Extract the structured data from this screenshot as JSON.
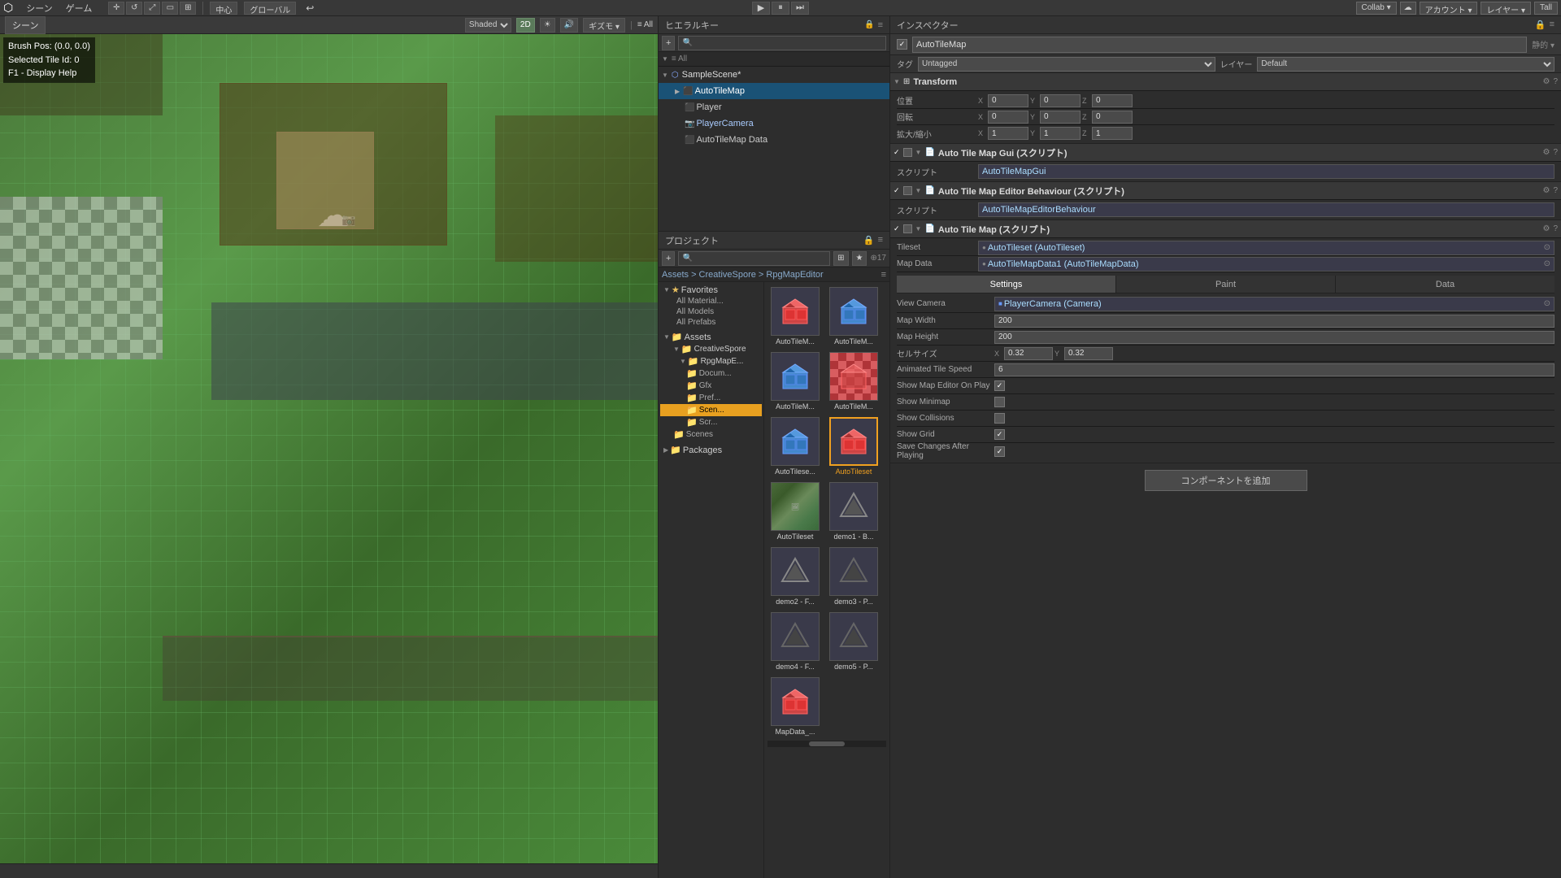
{
  "topbar": {
    "menu_items": [
      "シーン",
      "ゲーム"
    ],
    "tools": [
      "move",
      "rotate",
      "scale",
      "rect",
      "transform"
    ],
    "pivot": "中心",
    "space": "グローバル",
    "collab": "Collab ▾",
    "account": "アカウント ▾",
    "layers": "レイヤー ▾",
    "layout": "Tall"
  },
  "toolbar2": {
    "shaded": "Shaded",
    "mode2d": "2D",
    "gizmo": "ギズモ ▾",
    "alllayers": "≡ All"
  },
  "scene": {
    "tab": "シーン",
    "brush_pos": "Brush Pos: (0.0, 0.0)",
    "selected_tile": "Selected Tile Id: 0",
    "help": "F1 - Display Help"
  },
  "hierarchy": {
    "title": "ヒエラルキー",
    "scene_name": "SampleScene*",
    "items": [
      {
        "label": "AutoTileMap",
        "indent": 1,
        "type": "go"
      },
      {
        "label": "Player",
        "indent": 2,
        "type": "go"
      },
      {
        "label": "PlayerCamera",
        "indent": 2,
        "type": "cam"
      },
      {
        "label": "AutoTileMap Data",
        "indent": 2,
        "type": "go"
      }
    ]
  },
  "inspector": {
    "title": "インスペクター",
    "object_name": "AutoTileMap",
    "tag": "Untagged",
    "layer": "Default",
    "transform": {
      "title": "Transform",
      "position": {
        "label": "位置",
        "x": "0",
        "y": "0",
        "z": "0"
      },
      "rotation": {
        "label": "回転",
        "x": "0",
        "y": "0",
        "z": "0"
      },
      "scale": {
        "label": "拡大/縮小",
        "x": "1",
        "y": "1",
        "z": "1"
      }
    },
    "component1": {
      "title": "Auto Tile Map Gui (スクリプト)",
      "script_label": "スクリプト",
      "script_value": "AutoTileMapGui"
    },
    "component2": {
      "title": "Auto Tile Map Editor Behaviour (スクリプト)",
      "script_label": "スクリプト",
      "script_value": "AutoTileMapEditorBehaviour"
    },
    "component3": {
      "title": "Auto Tile Map (スクリプト)",
      "tileset_label": "Tileset",
      "tileset_value": "●AutoTileset (AutoTileset)",
      "mapdata_label": "Map Data",
      "mapdata_value": "●AutoTileMapData1 (AutoTileMapData)",
      "tabs": [
        "Settings",
        "Paint",
        "Data"
      ],
      "active_tab": 0,
      "view_camera_label": "View Camera",
      "view_camera_value": "■PlayerCamera (Camera)",
      "map_width_label": "Map Width",
      "map_width_value": "200",
      "map_height_label": "Map Height",
      "map_height_value": "200",
      "cell_size_label": "セルサイズ",
      "cell_x": "0.32",
      "cell_y": "0.32",
      "animated_speed_label": "Animated Tile Speed",
      "animated_speed_value": "6",
      "show_map_editor_label": "Show Map Editor On Play",
      "show_map_editor_checked": true,
      "show_minimap_label": "Show Minimap",
      "show_minimap_checked": false,
      "show_collisions_label": "Show Collisions",
      "show_collisions_checked": false,
      "show_grid_label": "Show Grid",
      "show_grid_checked": true,
      "save_changes_label": "Save Changes After Playing",
      "save_changes_checked": true
    },
    "add_component": "コンポーネントを追加"
  },
  "project": {
    "title": "プロジェクト",
    "breadcrumb": "Assets > CreativeSpore > RpgMapEditor",
    "favorites": {
      "label": "Favorites",
      "items": [
        "All Material...",
        "All Models",
        "All Prefabs"
      ]
    },
    "assets_tree": {
      "label": "Assets",
      "items": [
        {
          "label": "CreativeSpore",
          "indent": 1
        },
        {
          "label": "RpgMapE...",
          "indent": 2
        },
        {
          "label": "Docum...",
          "indent": 3
        },
        {
          "label": "Gfx",
          "indent": 3
        },
        {
          "label": "Pref...",
          "indent": 3
        },
        {
          "label": "Scen...",
          "indent": 3,
          "selected": true
        },
        {
          "label": "Scr...",
          "indent": 3
        },
        {
          "label": "Scenes",
          "indent": 1
        }
      ]
    },
    "packages": {
      "label": "Packages"
    },
    "assets": [
      {
        "label": "AutoTileM...",
        "type": "cube_red",
        "selected": false
      },
      {
        "label": "AutoTileM...",
        "type": "cube_blue",
        "selected": false
      },
      {
        "label": "AutoTileM...",
        "type": "cube_blue",
        "selected": false
      },
      {
        "label": "AutoTileM...",
        "type": "cube_red",
        "selected": false
      },
      {
        "label": "AutoTilese...",
        "type": "cube_blue",
        "selected": false
      },
      {
        "label": "AutoTileset",
        "type": "cube_red_selected",
        "selected": true
      },
      {
        "label": "AutoTileset",
        "type": "image",
        "selected": false
      },
      {
        "label": "demo1 - B...",
        "type": "unity",
        "selected": false
      },
      {
        "label": "demo2 - F...",
        "type": "unity",
        "selected": false
      },
      {
        "label": "demo3 - P...",
        "type": "unity_dark",
        "selected": false
      },
      {
        "label": "demo4 - F...",
        "type": "unity_dark",
        "selected": false
      },
      {
        "label": "demo5 - P...",
        "type": "unity_dark",
        "selected": false
      },
      {
        "label": "MapData_...",
        "type": "cube_red",
        "selected": false
      }
    ]
  }
}
